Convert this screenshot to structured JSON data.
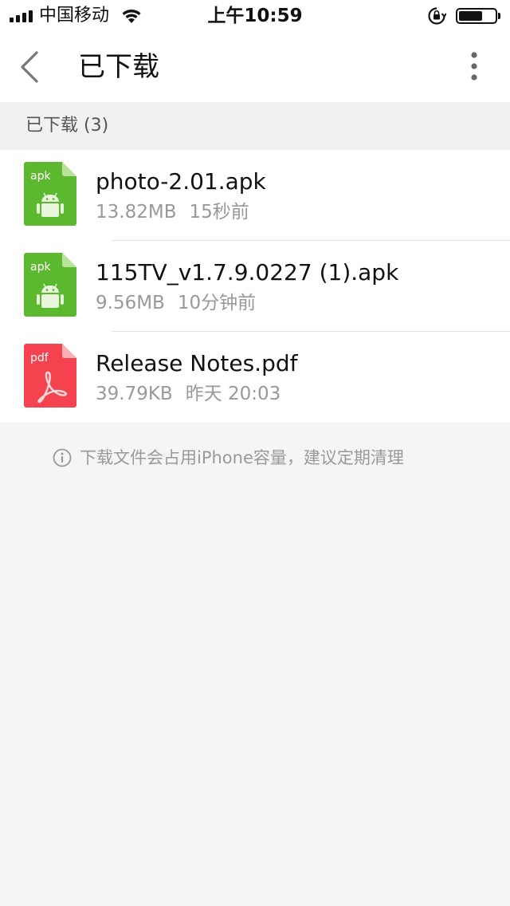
{
  "status_bar": {
    "carrier": "中国移动",
    "time": "上午10:59",
    "battery_level": 0.65
  },
  "nav": {
    "title": "已下载",
    "back_icon": "chevron-left-icon",
    "more_icon": "more-vertical-icon"
  },
  "section": {
    "header": "已下载 (3)"
  },
  "files": [
    {
      "name": "photo-2.01.apk",
      "size": "13.82MB",
      "time": "15秒前",
      "type_label": "apk",
      "icon": "android-apk-icon",
      "color": "#5cb82e"
    },
    {
      "name": "115TV_v1.7.9.0227 (1).apk",
      "size": "9.56MB",
      "time": "10分钟前",
      "type_label": "apk",
      "icon": "android-apk-icon",
      "color": "#5cb82e"
    },
    {
      "name": "Release Notes.pdf",
      "size": "39.79KB",
      "time": "昨天 20:03",
      "type_label": "pdf",
      "icon": "pdf-file-icon",
      "color": "#f5424f"
    }
  ],
  "hint": {
    "text": "下载文件会占用iPhone容量，建议定期清理",
    "icon": "info-icon"
  }
}
